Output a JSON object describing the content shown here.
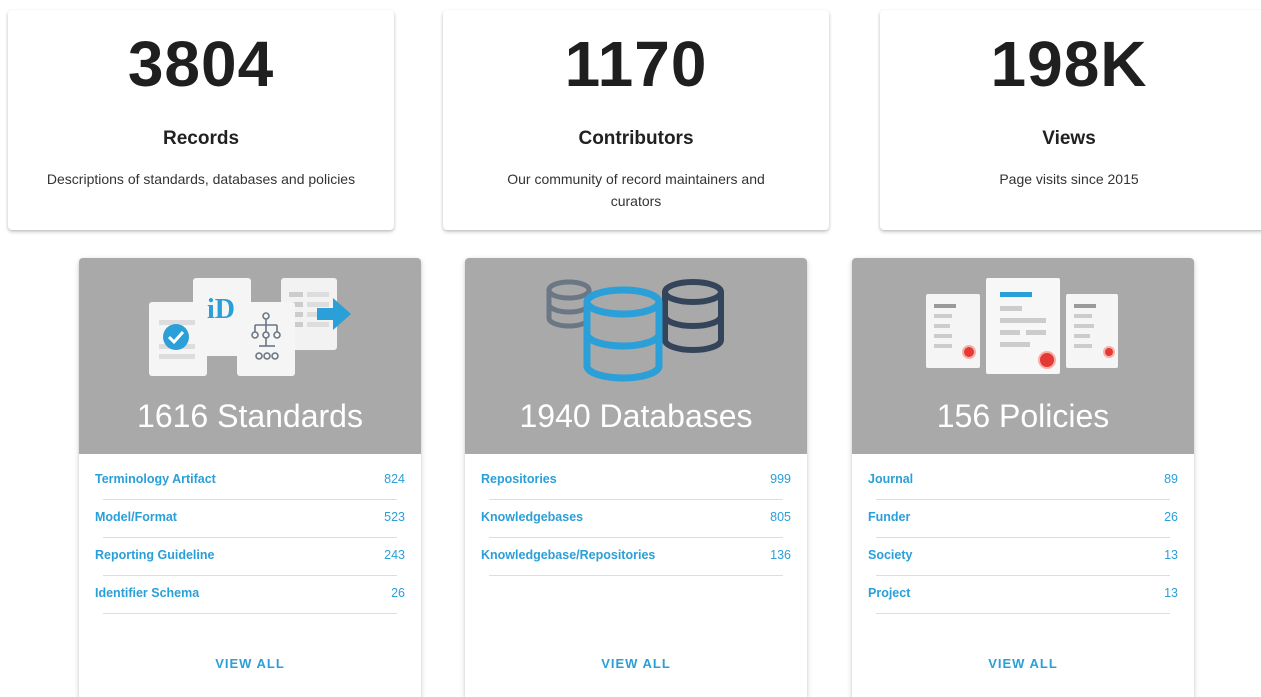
{
  "stats": [
    {
      "number": "3804",
      "title": "Records",
      "desc": "Descriptions of standards, databases and policies"
    },
    {
      "number": "1170",
      "title": "Contributors",
      "desc": "Our community of record maintainers and curators"
    },
    {
      "number": "198K",
      "title": "Views",
      "desc": "Page visits since 2015"
    }
  ],
  "categories": [
    {
      "icon": "standards-illustration-icon",
      "title": "1616 Standards",
      "items": [
        {
          "label": "Terminology Artifact",
          "count": "824"
        },
        {
          "label": "Model/Format",
          "count": "523"
        },
        {
          "label": "Reporting Guideline",
          "count": "243"
        },
        {
          "label": "Identifier Schema",
          "count": "26"
        }
      ],
      "view_all": "VIEW ALL"
    },
    {
      "icon": "databases-illustration-icon",
      "title": "1940 Databases",
      "items": [
        {
          "label": "Repositories",
          "count": "999"
        },
        {
          "label": "Knowledgebases",
          "count": "805"
        },
        {
          "label": "Knowledgebase/Repositories",
          "count": "136"
        }
      ],
      "view_all": "VIEW ALL"
    },
    {
      "icon": "policies-illustration-icon",
      "title": "156 Policies",
      "items": [
        {
          "label": "Journal",
          "count": "89"
        },
        {
          "label": "Funder",
          "count": "26"
        },
        {
          "label": "Society",
          "count": "13"
        },
        {
          "label": "Project",
          "count": "13"
        }
      ],
      "view_all": "VIEW ALL"
    }
  ],
  "colors": {
    "link": "#2a9fd8",
    "header_gray": "#a9a9a9",
    "icon_blue": "#2a9fd8",
    "icon_navy": "#34445a",
    "seal_red": "#e53935"
  }
}
